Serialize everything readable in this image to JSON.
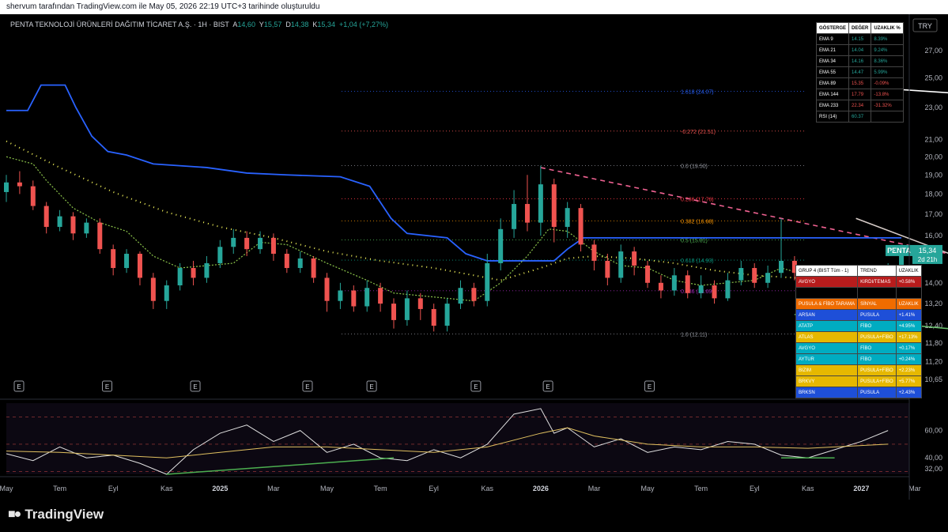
{
  "top_caption": "shervum tarafından TradingView.com ile May 05, 2026 22:19 UTC+3 tarihinde oluşturuldu",
  "header": {
    "title": "PENTA TEKNOLOJİ ÜRÜNLERİ DAĞITIM TİCARET A.Ş. · 1H · BIST",
    "open_label": "A",
    "open": "14,60",
    "high_label": "Y",
    "high": "15,57",
    "low_label": "D",
    "low": "14,38",
    "close_label": "K",
    "close": "15,34",
    "change": "+1,04 (+7,27%)"
  },
  "currency": "TRY",
  "price_badge": {
    "symbol": "PENTA",
    "price": "15,34",
    "time": "2d 21h"
  },
  "brand": "TradingView",
  "colors": {
    "up": "#26a69a",
    "down": "#ef5350",
    "ema_blue": "#2962ff",
    "background": "#000000"
  },
  "indicator_table": {
    "headers": [
      "GÖSTERGE",
      "DEĞER",
      "UZAKLIK %"
    ],
    "rows": [
      {
        "name": "EMA 9",
        "value": "14.15",
        "dist": "8.39%",
        "pos": true
      },
      {
        "name": "EMA 21",
        "value": "14.04",
        "dist": "9.24%",
        "pos": true
      },
      {
        "name": "EMA 34",
        "value": "14.16",
        "dist": "8.36%",
        "pos": true
      },
      {
        "name": "EMA 55",
        "value": "14.47",
        "dist": "5.99%",
        "pos": true
      },
      {
        "name": "EMA 89",
        "value": "15.35",
        "dist": "-0.09%",
        "pos": false
      },
      {
        "name": "EMA 144",
        "value": "17.79",
        "dist": "-13.8%",
        "pos": false
      },
      {
        "name": "EMA 233",
        "value": "22.34",
        "dist": "-31.32%",
        "pos": false
      },
      {
        "name": "RSI (14)",
        "value": "60.37",
        "dist": "",
        "pos": true
      }
    ]
  },
  "group_table": {
    "headers": [
      "GRUP 4 (BIST Tüm - 1)",
      "TREND",
      "UZAKLIK"
    ],
    "trend_row": {
      "name": "AVGYO",
      "trend": "KIRDI/TEMAS",
      "dist": "+0.58%"
    },
    "scan_headers": [
      "PUSULA & FİBO TARAMA",
      "SİNYAL",
      "UZAKLIK"
    ],
    "scan_rows": [
      {
        "name": "ARSAN",
        "signal": "PUSULA",
        "dist": "+1.41%",
        "type": "pusula"
      },
      {
        "name": "ATATP",
        "signal": "FİBO",
        "dist": "+4.95%",
        "type": "fibo"
      },
      {
        "name": "ATLAS",
        "signal": "PUSULA+FİBO",
        "dist": "+17.13%",
        "type": "both"
      },
      {
        "name": "AVGYO",
        "signal": "FİBO",
        "dist": "+0.17%",
        "type": "fibo"
      },
      {
        "name": "AYTUR",
        "signal": "FİBO",
        "dist": "+0.24%",
        "type": "fibo"
      },
      {
        "name": "BIZIM",
        "signal": "PUSULA+FİBO",
        "dist": "+2.23%",
        "type": "both"
      },
      {
        "name": "BRKVY",
        "signal": "PUSULA+FİBO",
        "dist": "+5.77%",
        "type": "both"
      },
      {
        "name": "BRKSN",
        "signal": "PUSULA",
        "dist": "+2.43%",
        "type": "pusula"
      }
    ]
  },
  "chart_data": {
    "type": "candlestick",
    "price_axis": {
      "scale": "log",
      "ticks": [
        "27,00",
        "25,00",
        "23,00",
        "21,00",
        "20,00",
        "19,00",
        "18,00",
        "17,00",
        "16,00",
        "15,00",
        "14,00",
        "13,20",
        "12,40",
        "11,80",
        "11,20",
        "10,65"
      ],
      "range": [
        10.3,
        28.5
      ]
    },
    "time_axis": {
      "labels": [
        "May",
        "Tem",
        "Eyl",
        "Kas",
        "2025",
        "Mar",
        "May",
        "Tem",
        "Eyl",
        "Kas",
        "2026",
        "Mar",
        "May",
        "Tem",
        "Eyl",
        "Kas",
        "2027",
        "Mar",
        "May"
      ],
      "bold": [
        "2025",
        "2026",
        "2027"
      ]
    },
    "fibonacci": [
      {
        "label": "1.618 (24.07)",
        "price": 24.07,
        "color": "#2962ff"
      },
      {
        "label": "-0.272 (21.51)",
        "price": 21.51,
        "color": "#ef5350"
      },
      {
        "label": "0.0 (19.50)",
        "price": 19.5,
        "color": "#9598a1"
      },
      {
        "label": "0.236 (17.76)",
        "price": 17.76,
        "color": "#f23645"
      },
      {
        "label": "0.382 (16.68)",
        "price": 16.68,
        "color": "#ff9800"
      },
      {
        "label": "0.5 (15.81)",
        "price": 15.81,
        "color": "#4caf50"
      },
      {
        "label": "0.618 (14.93)",
        "price": 14.93,
        "color": "#089981"
      },
      {
        "label": "0.786 (13.69)",
        "price": 13.69,
        "color": "#9c27b0"
      },
      {
        "label": "1.0 (12.11)",
        "price": 12.11,
        "color": "#9598a1"
      }
    ],
    "earnings_markers": [
      "E",
      "E",
      "E",
      "E",
      "E",
      "E",
      "E",
      "E"
    ],
    "earnings_months": [
      0,
      3.3,
      6.6,
      10.8,
      13.2,
      17.1,
      19.8,
      23.6
    ],
    "candles": [
      [
        0,
        18.1,
        18.6,
        19.0,
        17.6
      ],
      [
        0.5,
        18.6,
        18.4,
        19.2,
        18.0
      ],
      [
        1,
        18.4,
        17.4,
        18.7,
        17.2
      ],
      [
        1.5,
        17.4,
        16.4,
        17.6,
        16.1
      ],
      [
        2,
        16.4,
        16.9,
        17.2,
        16.2
      ],
      [
        2.5,
        16.9,
        16.1,
        17.1,
        15.8
      ],
      [
        3,
        16.1,
        16.6,
        16.8,
        15.9
      ],
      [
        3.5,
        16.6,
        15.4,
        16.8,
        15.2
      ],
      [
        4,
        15.4,
        14.6,
        15.6,
        14.3
      ],
      [
        4.5,
        14.6,
        15.2,
        15.4,
        14.4
      ],
      [
        5,
        15.2,
        14.2,
        15.3,
        13.9
      ],
      [
        5.5,
        14.2,
        13.3,
        14.4,
        13.0
      ],
      [
        6,
        13.3,
        13.9,
        14.1,
        13.0
      ],
      [
        6.5,
        13.9,
        14.6,
        14.8,
        13.7
      ],
      [
        7,
        14.6,
        14.2,
        14.9,
        13.9
      ],
      [
        7.5,
        14.2,
        14.8,
        15.1,
        14.0
      ],
      [
        8,
        14.8,
        15.5,
        15.8,
        14.6
      ],
      [
        8.5,
        15.5,
        15.9,
        16.3,
        15.2
      ],
      [
        9,
        15.9,
        15.4,
        16.2,
        15.1
      ],
      [
        9.5,
        15.4,
        15.9,
        16.2,
        15.2
      ],
      [
        10,
        15.9,
        15.2,
        16.1,
        14.9
      ],
      [
        10.5,
        15.2,
        14.6,
        15.4,
        14.4
      ],
      [
        11,
        14.6,
        15.0,
        15.3,
        14.4
      ],
      [
        11.5,
        15.0,
        14.2,
        15.1,
        14.0
      ],
      [
        12,
        14.2,
        13.3,
        14.4,
        12.9
      ],
      [
        12.5,
        13.3,
        13.7,
        14.0,
        13.0
      ],
      [
        13,
        13.7,
        13.1,
        13.9,
        12.9
      ],
      [
        13.5,
        13.1,
        13.8,
        14.1,
        12.9
      ],
      [
        14,
        13.8,
        13.2,
        14.0,
        12.9
      ],
      [
        14.5,
        13.2,
        12.6,
        13.4,
        12.3
      ],
      [
        15,
        12.6,
        13.4,
        13.7,
        12.4
      ],
      [
        15.5,
        13.4,
        13.0,
        13.6,
        12.6
      ],
      [
        16,
        13.0,
        12.4,
        13.2,
        12.2
      ],
      [
        16.5,
        12.4,
        13.2,
        13.4,
        12.2
      ],
      [
        17,
        13.2,
        13.8,
        14.1,
        13.0
      ],
      [
        17.5,
        13.8,
        13.3,
        14.0,
        13.1
      ],
      [
        18,
        13.3,
        14.8,
        15.2,
        13.1
      ],
      [
        18.5,
        14.8,
        16.3,
        16.8,
        14.5
      ],
      [
        19,
        16.3,
        17.5,
        18.2,
        15.9
      ],
      [
        19.5,
        17.5,
        16.6,
        19.0,
        16.2
      ],
      [
        20,
        16.6,
        18.5,
        19.5,
        16.0
      ],
      [
        20.5,
        18.5,
        16.4,
        18.8,
        15.7
      ],
      [
        21,
        16.4,
        17.3,
        17.6,
        15.9
      ],
      [
        21.5,
        17.3,
        15.6,
        17.5,
        15.3
      ],
      [
        22,
        15.6,
        14.9,
        15.8,
        14.5
      ],
      [
        22.5,
        14.9,
        14.2,
        15.2,
        13.9
      ],
      [
        23,
        14.2,
        15.3,
        15.6,
        14.0
      ],
      [
        23.5,
        15.3,
        14.7,
        15.5,
        14.3
      ],
      [
        24,
        14.7,
        14.0,
        14.9,
        13.8
      ],
      [
        24.5,
        14.0,
        13.7,
        14.3,
        13.4
      ],
      [
        25,
        13.7,
        14.3,
        14.6,
        13.5
      ],
      [
        25.5,
        14.3,
        13.6,
        14.5,
        13.4
      ],
      [
        26,
        13.6,
        13.9,
        14.3,
        13.4
      ],
      [
        26.5,
        13.9,
        13.4,
        14.1,
        13.2
      ],
      [
        27,
        13.4,
        14.1,
        14.4,
        13.3
      ],
      [
        27.5,
        14.1,
        14.6,
        14.9,
        13.9
      ],
      [
        28,
        14.6,
        14.0,
        14.8,
        13.8
      ],
      [
        28.5,
        14.0,
        14.4,
        14.7,
        13.8
      ],
      [
        29,
        14.4,
        14.9,
        16.8,
        14.2
      ],
      [
        29.5,
        14.9,
        14.4,
        15.1,
        14.1
      ],
      [
        30,
        14.4,
        13.5,
        14.6,
        13.2
      ],
      [
        30.5,
        13.5,
        13.0,
        13.7,
        12.7
      ],
      [
        31,
        13.0,
        13.6,
        13.8,
        12.8
      ],
      [
        31.5,
        13.6,
        13.1,
        13.8,
        12.9
      ],
      [
        32,
        13.1,
        13.8,
        14.0,
        12.9
      ],
      [
        32.5,
        13.8,
        14.3,
        14.6,
        13.6
      ],
      [
        33,
        14.3,
        14.6,
        14.8,
        14.1
      ],
      [
        33.5,
        14.6,
        15.34,
        15.57,
        14.38
      ]
    ],
    "ema_blue": [
      [
        0,
        22.8
      ],
      [
        0.8,
        22.8
      ],
      [
        1.3,
        24.5
      ],
      [
        2.2,
        24.5
      ],
      [
        2.6,
        23.0
      ],
      [
        3.2,
        21.2
      ],
      [
        3.8,
        20.3
      ],
      [
        4.5,
        20.1
      ],
      [
        5.5,
        19.6
      ],
      [
        7.5,
        19.4
      ],
      [
        9,
        19.1
      ],
      [
        10.5,
        19.0
      ],
      [
        12.5,
        18.9
      ],
      [
        13.6,
        18.4
      ],
      [
        14.4,
        16.8
      ],
      [
        15,
        16.1
      ],
      [
        16.5,
        15.9
      ],
      [
        17.2,
        15.2
      ],
      [
        18,
        14.9
      ],
      [
        20.5,
        14.9
      ],
      [
        21,
        15.4
      ],
      [
        21.6,
        15.9
      ],
      [
        33.5,
        15.9
      ]
    ],
    "ema_yellow": [
      [
        0,
        20.9
      ],
      [
        2,
        19.4
      ],
      [
        4,
        18.1
      ],
      [
        6,
        17.1
      ],
      [
        8,
        16.4
      ],
      [
        10,
        15.9
      ],
      [
        12,
        15.3
      ],
      [
        14,
        14.9
      ],
      [
        16,
        14.6
      ],
      [
        17.5,
        14.3
      ],
      [
        18.5,
        14.1
      ],
      [
        20,
        14.6
      ],
      [
        21,
        15.0
      ],
      [
        22,
        15.1
      ],
      [
        23.5,
        15.0
      ],
      [
        25,
        14.8
      ],
      [
        26.5,
        14.5
      ],
      [
        28,
        14.3
      ],
      [
        29.5,
        14.2
      ],
      [
        31,
        14.2
      ],
      [
        33,
        14.1
      ]
    ],
    "ema_green": [
      [
        0,
        20.0
      ],
      [
        1,
        19.6
      ],
      [
        1.5,
        18.7
      ],
      [
        2.5,
        17.3
      ],
      [
        3.5,
        16.6
      ],
      [
        4.5,
        16.2
      ],
      [
        5.5,
        15.1
      ],
      [
        6.5,
        14.6
      ],
      [
        8.5,
        14.8
      ],
      [
        9.5,
        15.7
      ],
      [
        10.5,
        15.6
      ],
      [
        12,
        14.8
      ],
      [
        13.5,
        14.1
      ],
      [
        14.5,
        13.6
      ],
      [
        15.5,
        13.5
      ],
      [
        16.5,
        13.4
      ],
      [
        17.5,
        13.3
      ],
      [
        18.5,
        14.0
      ],
      [
        19.5,
        15.1
      ],
      [
        20.3,
        16.3
      ],
      [
        21,
        16.2
      ],
      [
        22,
        15.3
      ],
      [
        23,
        14.7
      ],
      [
        24,
        14.6
      ],
      [
        25,
        14.1
      ],
      [
        26,
        13.9
      ],
      [
        27,
        14.0
      ],
      [
        28,
        14.1
      ],
      [
        29,
        14.6
      ],
      [
        30,
        14.3
      ],
      [
        31,
        14.0
      ],
      [
        32,
        14.0
      ],
      [
        33,
        14.1
      ]
    ],
    "rsi": {
      "ticks": [
        "60,00",
        "40,00",
        "32,00"
      ],
      "range": [
        28,
        80
      ],
      "values": [
        [
          0,
          43
        ],
        [
          1,
          38
        ],
        [
          2,
          48
        ],
        [
          3,
          40
        ],
        [
          4,
          42
        ],
        [
          5,
          36
        ],
        [
          6,
          28
        ],
        [
          7,
          46
        ],
        [
          8,
          58
        ],
        [
          9,
          64
        ],
        [
          10,
          52
        ],
        [
          11,
          60
        ],
        [
          12,
          44
        ],
        [
          13,
          50
        ],
        [
          14,
          40
        ],
        [
          15,
          38
        ],
        [
          16,
          46
        ],
        [
          17,
          40
        ],
        [
          18,
          50
        ],
        [
          19,
          72
        ],
        [
          20,
          76
        ],
        [
          20.5,
          58
        ],
        [
          21,
          62
        ],
        [
          22,
          48
        ],
        [
          23,
          54
        ],
        [
          24,
          44
        ],
        [
          25,
          48
        ],
        [
          26,
          46
        ],
        [
          27,
          52
        ],
        [
          28,
          50
        ],
        [
          29,
          42
        ],
        [
          30,
          40
        ],
        [
          31,
          46
        ],
        [
          32,
          52
        ],
        [
          33,
          60
        ]
      ],
      "ma": [
        [
          0,
          45
        ],
        [
          2,
          44
        ],
        [
          4,
          42
        ],
        [
          6,
          40
        ],
        [
          8,
          44
        ],
        [
          10,
          48
        ],
        [
          12,
          48
        ],
        [
          14,
          46
        ],
        [
          16,
          44
        ],
        [
          18,
          48
        ],
        [
          20,
          58
        ],
        [
          21,
          62
        ],
        [
          22,
          56
        ],
        [
          24,
          50
        ],
        [
          26,
          48
        ],
        [
          28,
          48
        ],
        [
          30,
          47
        ],
        [
          32,
          49
        ],
        [
          33,
          50
        ]
      ]
    },
    "trendlines": [
      {
        "color": "#ffffff",
        "from": [
          31.0,
          24.5
        ],
        "to": [
          45.0,
          22.8
        ]
      },
      {
        "color": "#f06292",
        "from": [
          20.0,
          19.4
        ],
        "to": [
          48.0,
          12.4
        ],
        "dashed": true
      },
      {
        "color": "#d7ccc8",
        "from": [
          31.8,
          16.8
        ],
        "to": [
          50.0,
          10.0
        ]
      },
      {
        "color": "#66bb6a",
        "from": [
          29.5,
          12.8
        ],
        "to": [
          56.0,
          10.65
        ]
      }
    ]
  }
}
